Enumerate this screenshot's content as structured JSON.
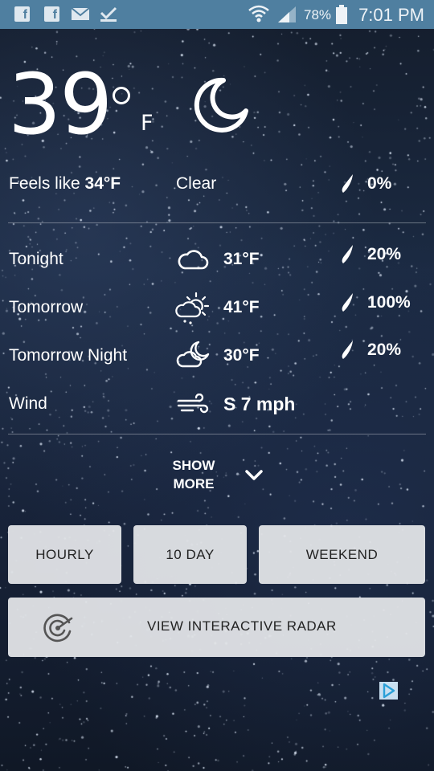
{
  "status_bar": {
    "battery": "78%",
    "time": "7:01 PM"
  },
  "current": {
    "temperature": "39",
    "unit": "F",
    "feels_like_label": "Feels like",
    "feels_like_value": "34°F",
    "condition": "Clear",
    "precip": "0%"
  },
  "forecast": [
    {
      "period": "Tonight",
      "icon": "cloud-icon",
      "temp": "31°F",
      "precip": "20%"
    },
    {
      "period": "Tomorrow",
      "icon": "sun-rain-icon",
      "temp": "41°F",
      "precip": "100%"
    },
    {
      "period": "Tomorrow Night",
      "icon": "moon-cloud-icon",
      "temp": "30°F",
      "precip": "20%"
    }
  ],
  "wind": {
    "label": "Wind",
    "value": "S 7 mph"
  },
  "show_more": {
    "line1": "SHOW",
    "line2": "MORE"
  },
  "buttons": {
    "hourly": "HOURLY",
    "ten_day": "10 DAY",
    "weekend": "WEEKEND",
    "radar": "VIEW INTERACTIVE RADAR"
  }
}
